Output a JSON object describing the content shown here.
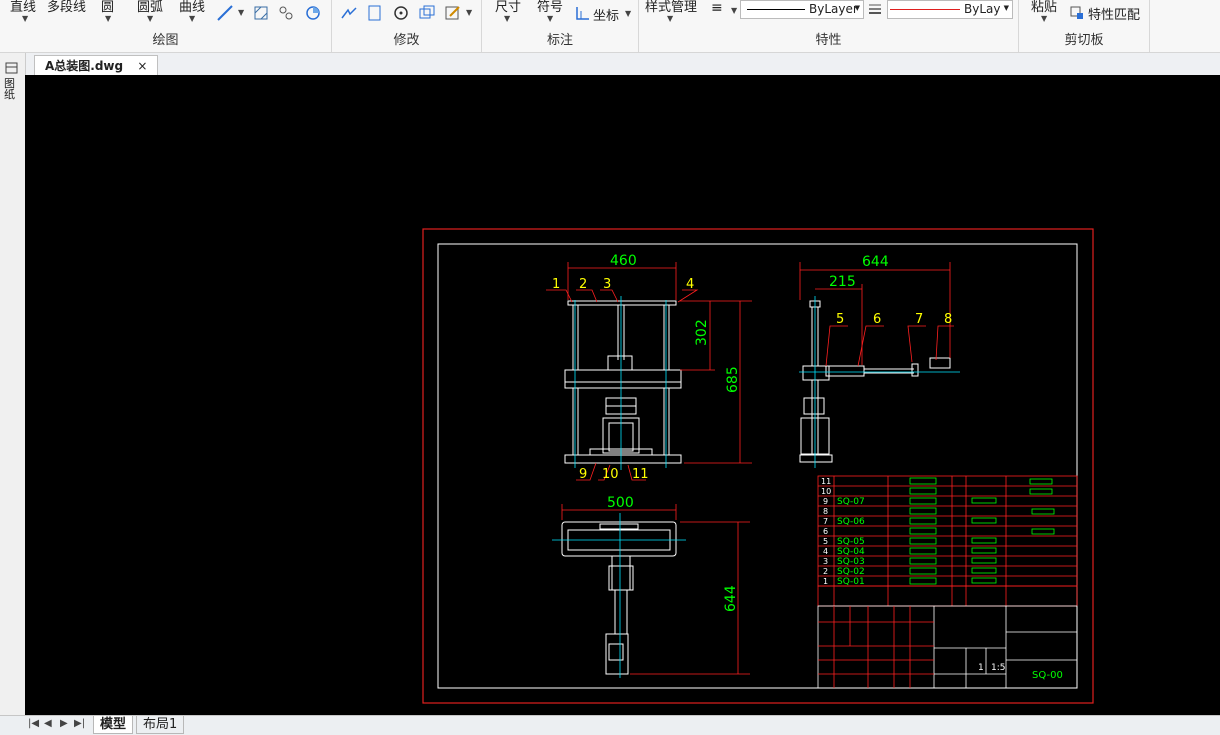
{
  "ribbon": {
    "draw": {
      "line": "直线",
      "polyline": "多段线",
      "circle": "圆",
      "arc": "圆弧",
      "curve": "曲线",
      "label": "绘图"
    },
    "modify": {
      "label": "修改"
    },
    "annotate": {
      "dimension": "尺寸",
      "symbol": "符号",
      "coordinate": "坐标",
      "label": "标注"
    },
    "properties": {
      "style_mgr": "样式管理",
      "linetype": "ByLayer",
      "lineweight": "ByLayer",
      "label": "特性"
    },
    "clipboard": {
      "paste": "粘贴",
      "match": "特性匹配",
      "label": "剪切板"
    }
  },
  "side_panel": {
    "label": "图纸"
  },
  "document_tab": {
    "title": "A总装图.dwg",
    "close": "×"
  },
  "layout_tabs": {
    "model": "模型",
    "layout1": "布局1"
  },
  "drawing": {
    "front_dims": {
      "width": "460",
      "top_h": "302",
      "total_h": "685"
    },
    "side_dims": {
      "total_w": "644",
      "partial_w": "215"
    },
    "top_dims": {
      "width": "500",
      "height": "644"
    },
    "balloons_front_top": [
      "1",
      "2",
      "3",
      "4"
    ],
    "balloons_front_bottom": [
      "9",
      "10",
      "11"
    ],
    "balloons_side": [
      "5",
      "6",
      "7",
      "8"
    ],
    "bom_rows": [
      {
        "no": "11",
        "code": ""
      },
      {
        "no": "10",
        "code": ""
      },
      {
        "no": "9",
        "code": "SQ-07"
      },
      {
        "no": "8",
        "code": ""
      },
      {
        "no": "7",
        "code": "SQ-06"
      },
      {
        "no": "6",
        "code": ""
      },
      {
        "no": "5",
        "code": "SQ-05"
      },
      {
        "no": "4",
        "code": "SQ-04"
      },
      {
        "no": "3",
        "code": "SQ-03"
      },
      {
        "no": "2",
        "code": "SQ-02"
      },
      {
        "no": "1",
        "code": "SQ-01"
      }
    ],
    "title_block": {
      "drawing_no": "SQ-00",
      "scale": "1:5",
      "qty": "1"
    }
  },
  "colors": {
    "frame_red": "#e0201e",
    "green": "#00ff00",
    "white": "#ffffff",
    "red": "#ff2020",
    "cyan": "#00e5ff",
    "yellow": "#ffff00"
  }
}
